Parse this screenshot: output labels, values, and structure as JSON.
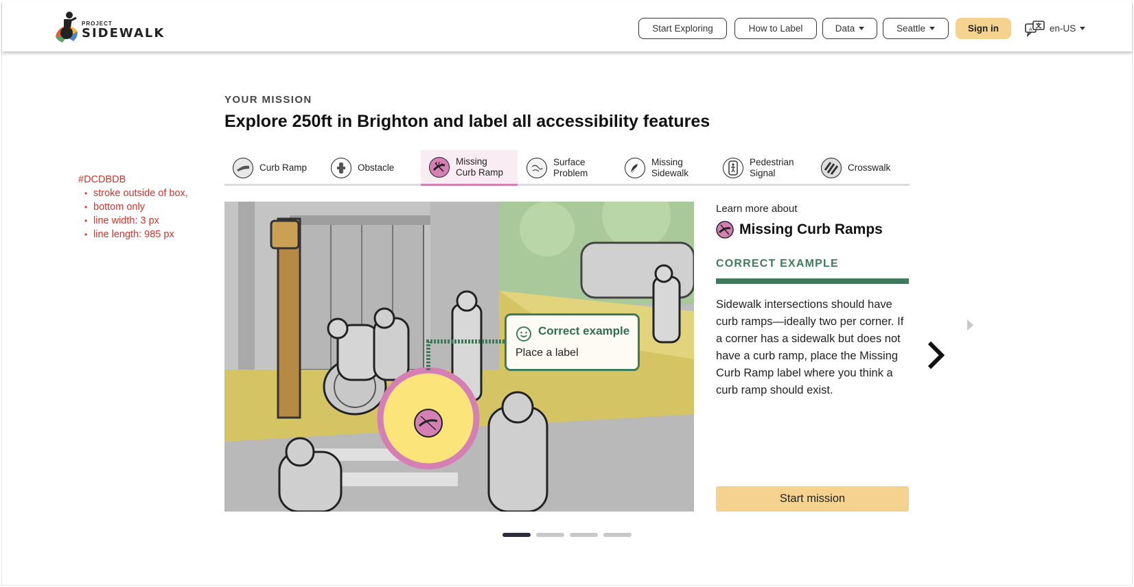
{
  "header": {
    "logo_small": "PROJECT",
    "logo_big": "SIDEWALK",
    "nav": {
      "start_exploring": "Start Exploring",
      "how_to_label": "How to Label",
      "data": "Data",
      "city": "Seattle"
    },
    "sign_in": "Sign in",
    "language": "en-US"
  },
  "annotation": {
    "color_code": "#DCDBDB",
    "notes": [
      "stroke outside of box,",
      "bottom only",
      "line width: 3 px",
      "line length: 985 px"
    ]
  },
  "mission": {
    "label": "YOUR MISSION",
    "title": "Explore 250ft in Brighton and label all accessibility features"
  },
  "tabs": [
    {
      "line1": "Curb Ramp",
      "line2": "",
      "icon": "curb-ramp-icon"
    },
    {
      "line1": "Obstacle",
      "line2": "",
      "icon": "obstacle-icon"
    },
    {
      "line1": "Missing",
      "line2": "Curb Ramp",
      "icon": "missing-curb-ramp-icon"
    },
    {
      "line1": "Surface",
      "line2": "Problem",
      "icon": "surface-problem-icon"
    },
    {
      "line1": "Missing",
      "line2": "Sidewalk",
      "icon": "missing-sidewalk-icon"
    },
    {
      "line1": "Pedestrian",
      "line2": "Signal",
      "icon": "pedestrian-signal-icon"
    },
    {
      "line1": "Crosswalk",
      "line2": "",
      "icon": "crosswalk-icon"
    }
  ],
  "scene": {
    "tooltip_title": "Correct example",
    "tooltip_sub": "Place a label"
  },
  "panel": {
    "learn_more": "Learn more about",
    "label_title": "Missing Curb Ramps",
    "section": "CORRECT EXAMPLE",
    "description": "Sidewalk intersections should have curb ramps—ideally two per corner. If a corner has a sidewalk but does not have a curb ramp, place the Missing Curb Ramp label where you think a curb ramp should exist.",
    "start_button": "Start mission"
  },
  "colors": {
    "accent_green": "#3e7a5c",
    "button_yellow": "#f4d390",
    "tab_active_bg": "#faecf3",
    "tab_active_border": "#d580b5",
    "tab_underline": "#dcdbdb",
    "annotation_red": "#d0342c"
  },
  "carousel": {
    "total": 4,
    "active": 1
  }
}
